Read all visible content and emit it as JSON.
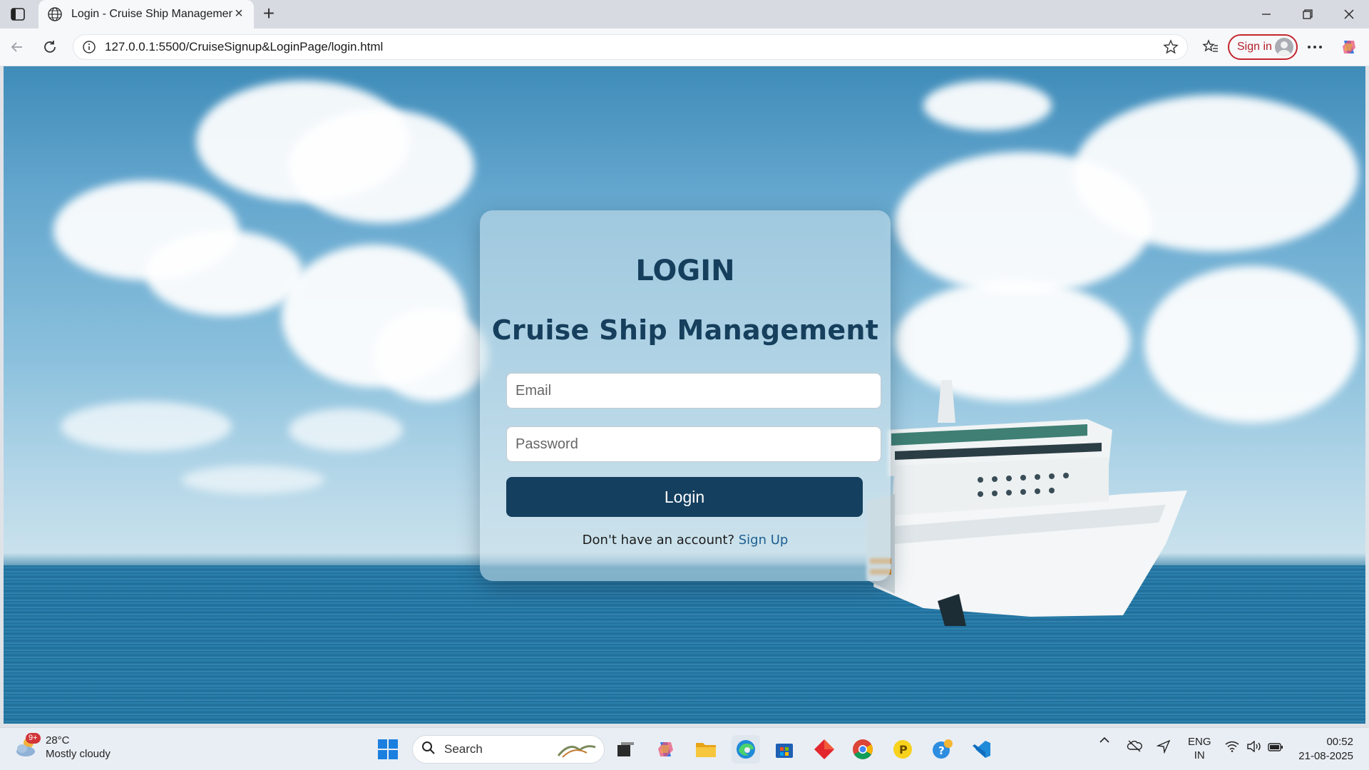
{
  "browser": {
    "tab": {
      "title": "Login - Cruise Ship Management",
      "icon": "globe-icon"
    },
    "address": {
      "url": "127.0.0.1:5500/CruiseSignup&LoginPage/login.html"
    },
    "signin_label": "Sign in"
  },
  "page": {
    "heading": "LOGIN",
    "subheading": "Cruise Ship Management",
    "email_placeholder": "Email",
    "email_value": "",
    "password_placeholder": "Password",
    "password_value": "",
    "login_button": "Login",
    "signup_prompt": "Don't have an account?",
    "signup_link": "Sign Up"
  },
  "taskbar": {
    "weather": {
      "temp": "28°C",
      "condition": "Mostly cloudy",
      "badge": "9+"
    },
    "search_label": "Search",
    "language": {
      "line1": "ENG",
      "line2": "IN"
    },
    "clock": {
      "time": "00:52",
      "date": "21-08-2025"
    }
  },
  "colors": {
    "card_heading": "#153f5c",
    "button_bg": "#143f5f",
    "link": "#1c5f92",
    "signin_border": "#c4262e"
  }
}
